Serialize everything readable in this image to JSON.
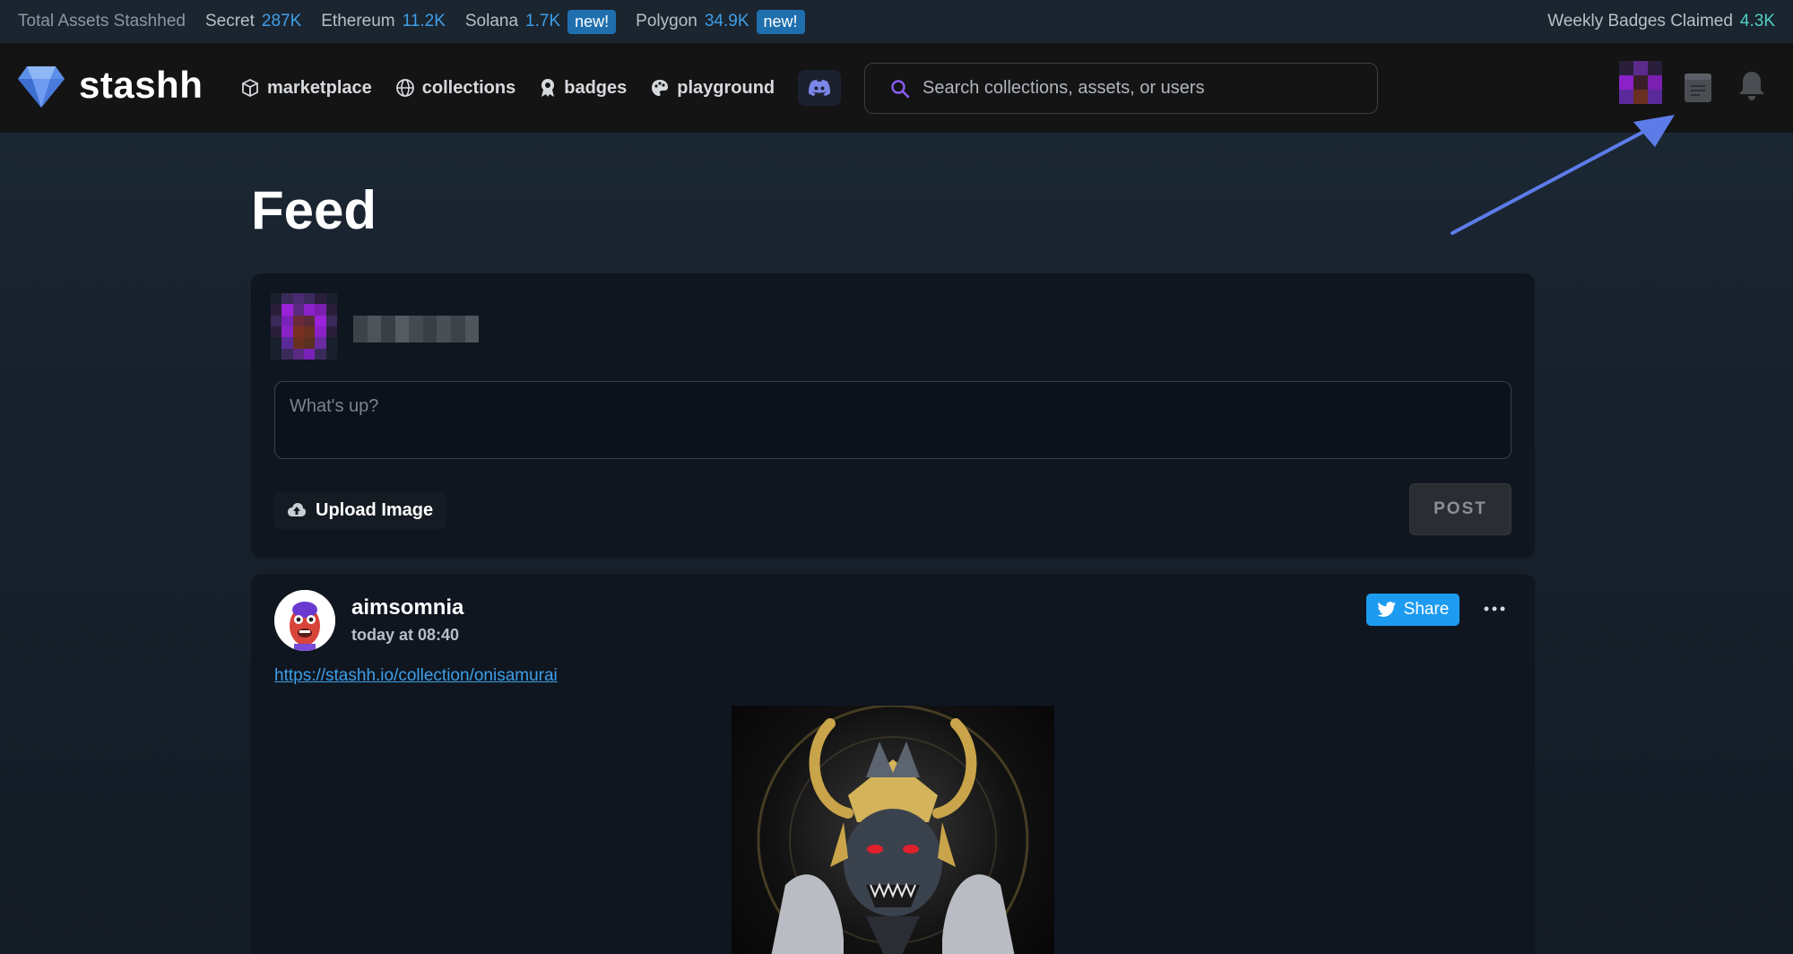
{
  "ticker": {
    "total_label": "Total Assets Stashhed",
    "items": [
      {
        "label": "Secret",
        "value": "287K",
        "badge": ""
      },
      {
        "label": "Ethereum",
        "value": "11.2K",
        "badge": ""
      },
      {
        "label": "Solana",
        "value": "1.7K",
        "badge": "new!"
      },
      {
        "label": "Polygon",
        "value": "34.9K",
        "badge": "new!"
      }
    ],
    "weekly_label": "Weekly Badges Claimed",
    "weekly_value": "4.3K"
  },
  "header": {
    "brand": "stashh",
    "nav": [
      {
        "label": "marketplace",
        "icon": "cube-icon"
      },
      {
        "label": "collections",
        "icon": "globe-icon"
      },
      {
        "label": "badges",
        "icon": "award-icon"
      },
      {
        "label": "playground",
        "icon": "palette-icon"
      }
    ],
    "search_placeholder": "Search collections, assets, or users"
  },
  "feed": {
    "title": "Feed",
    "composer": {
      "placeholder": "What's up?",
      "upload_label": "Upload Image",
      "post_label": "POST"
    },
    "post": {
      "username": "aimsomnia",
      "time": "today at 08:40",
      "share_label": "Share",
      "link": "https://stashh.io/collection/onisamurai"
    }
  },
  "colors": {
    "accent_blue": "#3f9ee8",
    "teal": "#4fd0c4",
    "badge_blue": "#1f6fae",
    "twitter_blue": "#1d9bf0",
    "arrow": "#5d7ce8"
  }
}
